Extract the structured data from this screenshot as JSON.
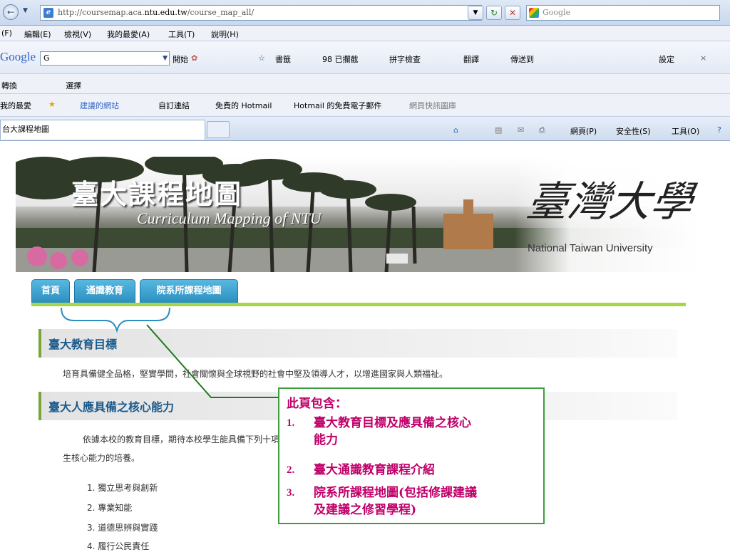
{
  "browser": {
    "url_prefix": "http://coursemap.aca.",
    "url_domain": "ntu.edu.tw",
    "url_path": "/course_map_all/",
    "search_placeholder": "Google",
    "menu": [
      "(F)",
      "編輯(E)",
      "檢視(V)",
      "我的最愛(A)",
      "工具(T)",
      "說明(H)"
    ],
    "google_logo": "Google",
    "google_box": "G",
    "google_items": [
      "開始",
      "書籤",
      "98 已攔截",
      "拼字檢查",
      "翻譯",
      "傳送到",
      "設定",
      "×"
    ],
    "row3_items": [
      "轉換",
      "選擇"
    ],
    "favorites_label": "我的最愛",
    "favorites_items": [
      "建議的網站",
      "自訂連結",
      "免費的 Hotmail",
      "Hotmail 的免費電子郵件",
      "網頁快訊圖庫"
    ],
    "tab_title": "台大課程地圖",
    "commands": [
      "網頁(P)",
      "安全性(S)",
      "工具(O)"
    ]
  },
  "banner": {
    "title": "臺大課程地圖",
    "subtitle": "Curriculum Mapping of NTU",
    "calligraphy": "臺灣大學",
    "university_en": "National Taiwan University"
  },
  "nav_tabs": [
    "首頁",
    "通識教育",
    "院系所課程地圖"
  ],
  "sections": [
    {
      "heading": "臺大教育目標",
      "body": "培育具備健全品格，堅實學問，社會關懷與全球視野的社會中堅及領導人才，以增進國家與人類福祉。"
    },
    {
      "heading": "臺大人應具備之核心能力",
      "body_line1": "依據本校的教育目標，期待本校學生能具備下列十項核心能力，並藉由本校通識教育及專業系所提供之教學活動，達成學",
      "body_line2": "生核心能力的培養。",
      "list": [
        "1.  獨立思考與創新",
        "2.  專業知能",
        "3.  道德思辨與實踐",
        "4.  履行公民責任"
      ]
    }
  ],
  "callout": {
    "title": "此頁包含：",
    "items": [
      {
        "num": "1.",
        "line1": "臺大教育目標及應具備之核心",
        "line2": "能力"
      },
      {
        "num": "2.",
        "line1": "臺大通識教育課程介紹",
        "line2": ""
      },
      {
        "num": "3.",
        "line1": "院系所課程地圖(包括修課建議",
        "line2": "及建議之修習學程)"
      }
    ]
  },
  "colors": {
    "callout_text": "#c0006a",
    "callout_border": "#3e9e3e",
    "nav_tab": "#2b8fc0",
    "green_rule": "#a6d645",
    "section_heading": "#1a5a8c"
  }
}
